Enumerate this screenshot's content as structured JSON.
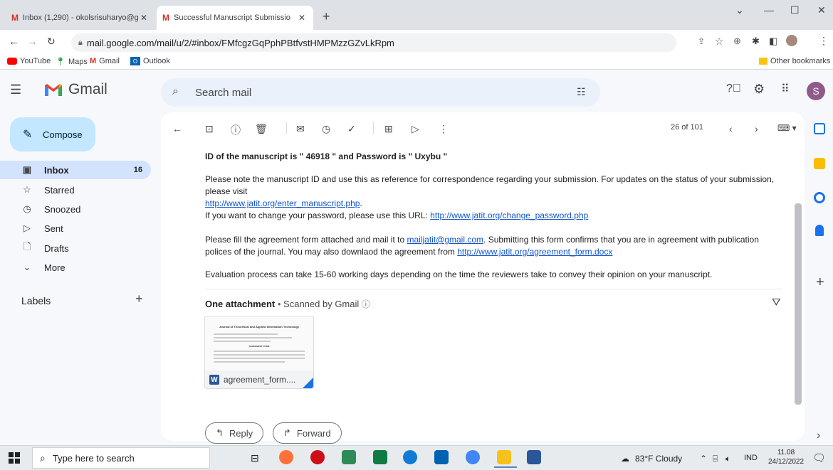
{
  "browser": {
    "tabs": [
      {
        "title": "Inbox (1,290) - okolsrisuharyo@g",
        "active": false
      },
      {
        "title": "Successful Manuscript Submissio",
        "active": true
      }
    ],
    "url": "mail.google.com/mail/u/2/#inbox/FMfcgzGqPphPBtfvstHMPMzzGZvLkRpm",
    "bookmarks": [
      "YouTube",
      "Maps",
      "Gmail",
      "Outlook"
    ],
    "other_bookmarks": "Other bookmarks"
  },
  "gmail": {
    "logo_text": "Gmail",
    "search_placeholder": "Search mail",
    "avatar_letter": "S",
    "compose": "Compose",
    "nav": [
      {
        "label": "Inbox",
        "count": "16",
        "icon": "inbox-icon"
      },
      {
        "label": "Starred",
        "count": "",
        "icon": "star-icon"
      },
      {
        "label": "Snoozed",
        "count": "",
        "icon": "clock-icon"
      },
      {
        "label": "Sent",
        "count": "",
        "icon": "send-icon"
      },
      {
        "label": "Drafts",
        "count": "",
        "icon": "draft-icon"
      },
      {
        "label": "More",
        "count": "",
        "icon": "chevron-down-icon"
      }
    ],
    "labels_heading": "Labels",
    "pager": "26 of 101"
  },
  "email": {
    "id_line": "ID of the manuscript is \" 46918 \" and Password is \" Uxybu \"",
    "p1": "Please note the manuscript ID and use this as reference for correspondence regarding your submission. For updates on the status of your submission, please visit",
    "p1_link": "http://www.jatit.org/enter_manuscript.php",
    "p1_end": ".",
    "p2": "If you want to change your password, please use this URL: ",
    "p2_link": "http://www.jatit.org/change_password.php",
    "p3a": "Please fill the agreement form attached and mail it to ",
    "p3_mail": "mailjatit@gmail.com",
    "p3b": ". Submitting this form confirms that you are in agreement with publication polices of the journal. You may also downlaod the agreement from ",
    "p3_link": "http://www.jatit.org/agreement_form.docx",
    "p4": "Evaluation process can take 15-60 working days depending on the time the reviewers take to convey their opinion on your manuscript.",
    "attachment_title": "One attachment",
    "scanned": "Scanned by Gmail",
    "attachment_name": "agreement_form....",
    "attachment_preview_title": "Journal of Theoretical and Applied Information Technology",
    "attachment_preview_heading": "AGREEMENT FORM",
    "reply": "Reply",
    "forward": "Forward"
  },
  "taskbar": {
    "search_placeholder": "Type here to search",
    "weather": "83°F  Cloudy",
    "lang": "IND",
    "time": "11.08",
    "date": "24/12/2022"
  },
  "colors": {
    "accent": "#0b57d0",
    "selected_nav": "#d3e3fd",
    "compose_bg": "#c2e7ff",
    "link": "#1155cc"
  }
}
